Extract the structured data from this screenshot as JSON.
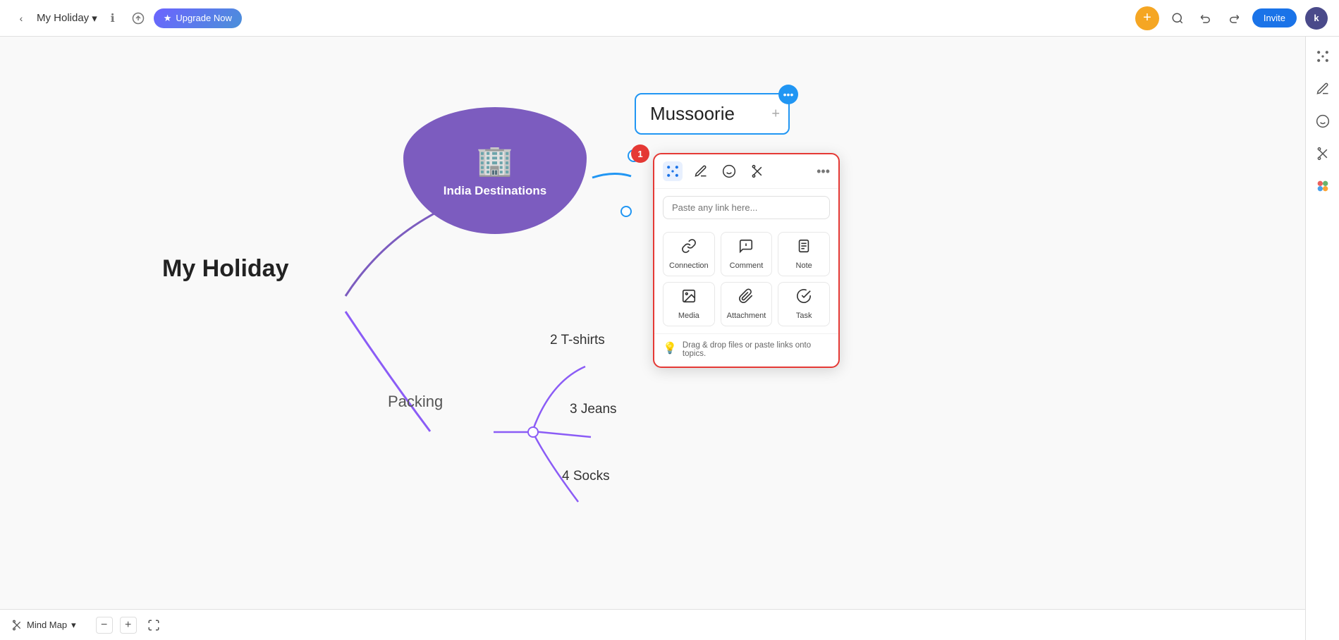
{
  "topbar": {
    "back_icon": "‹",
    "project_name": "My Holiday",
    "chevron": "▾",
    "info_icon": "ℹ",
    "upload_icon": "⬆",
    "upgrade_label": "Upgrade Now",
    "upgrade_star": "★",
    "add_icon": "+",
    "search_icon": "🔍",
    "undo_icon": "↩",
    "redo_icon": "↪",
    "invite_label": "Invite",
    "avatar_label": "k"
  },
  "mindmap": {
    "central_node": "My Holiday",
    "india_node_label": "India Destinations",
    "india_node_icon": "🏢",
    "mussoorie_label": "Mussoorie",
    "packing_label": "Packing",
    "tshirt_label": "2 T-shirts",
    "jeans_label": "3 Jeans",
    "socks_label": "4 Socks"
  },
  "popup": {
    "toolbar": {
      "connections_icon": "⣿",
      "style_icon": "✏",
      "emoji_icon": "☺",
      "cut_icon": "✂",
      "more_icon": "•••"
    },
    "link_placeholder": "Paste any link here...",
    "grid_items": [
      {
        "icon": "🔗",
        "label": "Connection"
      },
      {
        "icon": "💬",
        "label": "Comment"
      },
      {
        "icon": "≡",
        "label": "Note"
      },
      {
        "icon": "🖼",
        "label": "Media"
      },
      {
        "icon": "📎",
        "label": "Attachment"
      },
      {
        "icon": "✅",
        "label": "Task"
      }
    ],
    "hint_emoji": "💡",
    "hint_text": "Drag & drop files or paste links onto topics."
  },
  "right_sidebar": {
    "icons": [
      "⣿",
      "✏",
      "☺",
      "✂",
      "🌈"
    ]
  },
  "bottombar": {
    "map_type": "Mind Map",
    "chevron": "▾",
    "zoom_minus": "−",
    "zoom_plus": "+",
    "fullscreen_icon": "⛶",
    "help_icon": "?"
  },
  "badge": {
    "number": "1"
  }
}
